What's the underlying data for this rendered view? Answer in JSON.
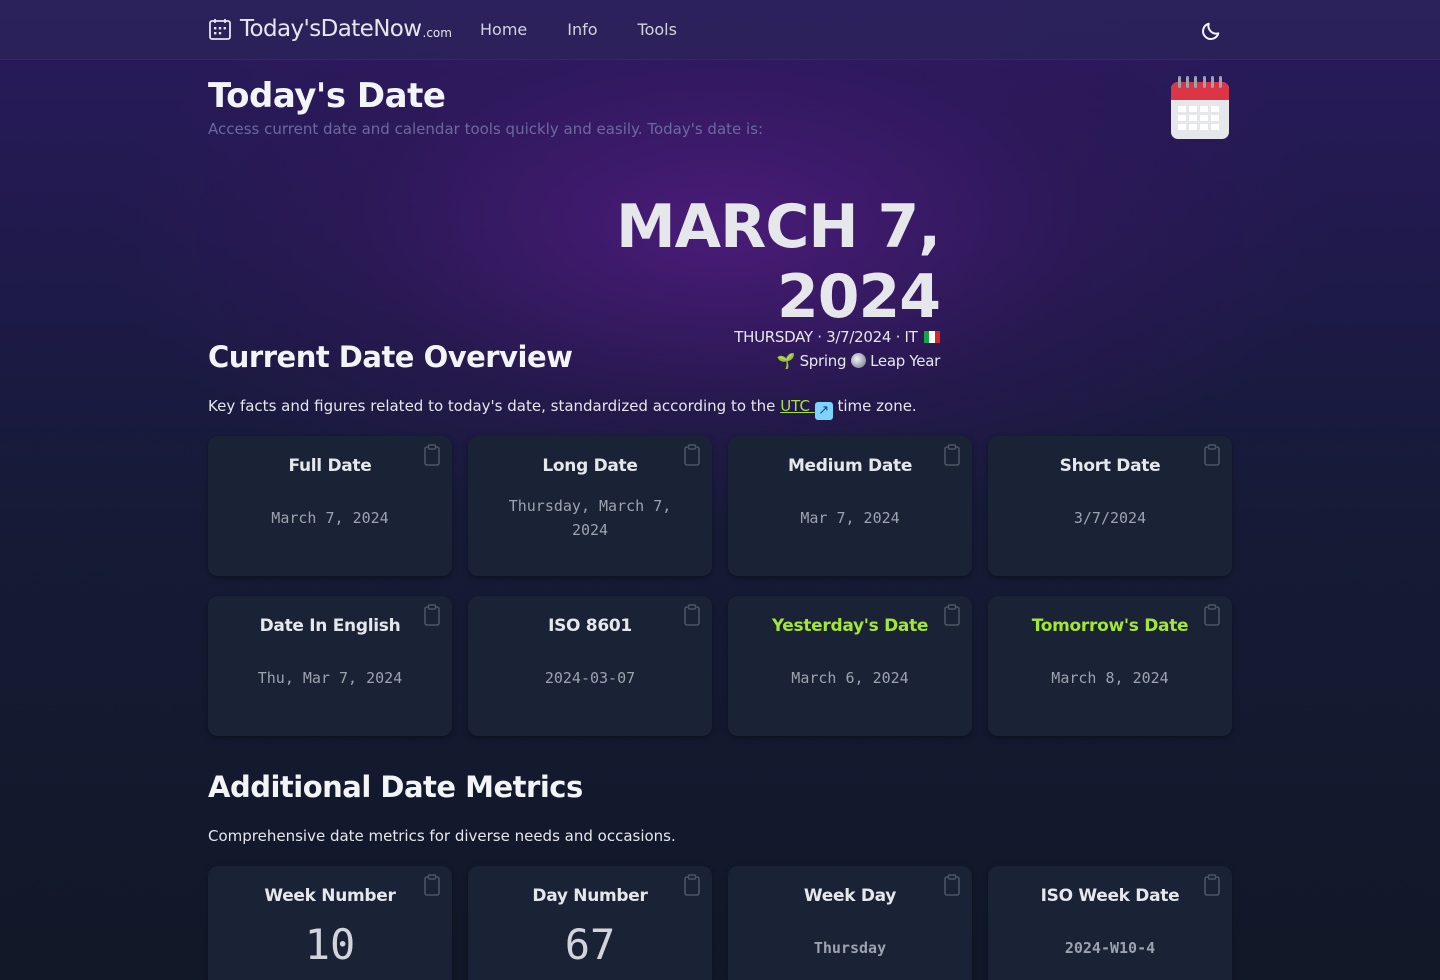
{
  "header": {
    "brand_name": "Today'sDateNow",
    "brand_suffix": ".com",
    "nav": [
      {
        "label": "Home"
      },
      {
        "label": "Info"
      },
      {
        "label": "Tools"
      }
    ]
  },
  "title": {
    "heading": "Today's Date",
    "subtitle": "Access current date and calendar tools quickly and easily. Today's date is:"
  },
  "hero": {
    "date": "MARCH 7, 2024",
    "line1": "THURSDAY · 3/7/2024 · IT",
    "season": "Spring",
    "leap": "Leap Year"
  },
  "overview": {
    "title": "Current Date Overview",
    "desc_before": "Key facts and figures related to today's date, standardized according to the ",
    "desc_link": "UTC",
    "desc_after": " time zone.",
    "cards": [
      {
        "title": "Full Date",
        "value": "March 7, 2024"
      },
      {
        "title": "Long Date",
        "value": "Thursday, March 7, 2024"
      },
      {
        "title": "Medium Date",
        "value": "Mar 7, 2024"
      },
      {
        "title": "Short Date",
        "value": "3/7/2024"
      },
      {
        "title": "Date In English",
        "value": "Thu, Mar 7, 2024"
      },
      {
        "title": "ISO 8601",
        "value": "2024-03-07"
      },
      {
        "title": "Yesterday's Date",
        "value": "March 6, 2024"
      },
      {
        "title": "Tomorrow's Date",
        "value": "March 8, 2024"
      }
    ]
  },
  "metrics": {
    "title": "Additional Date Metrics",
    "desc": "Comprehensive date metrics for diverse needs and occasions.",
    "cards": [
      {
        "title": "Week Number",
        "value": "10"
      },
      {
        "title": "Day Number",
        "value": "67"
      },
      {
        "title": "Week Day",
        "value": "Thursday"
      },
      {
        "title": "ISO Week Date",
        "value": "2024-W10-4"
      }
    ]
  },
  "colors": {
    "accent_green": "#a3e635",
    "card_bg": "#1a2235",
    "hero_glow": "#581c87"
  },
  "icons": {
    "brand": "calendar-grid-icon",
    "theme": "moon-icon",
    "hero_badge": "calendar-emoji-icon",
    "copy": "clipboard-icon",
    "external": "external-link-icon"
  }
}
